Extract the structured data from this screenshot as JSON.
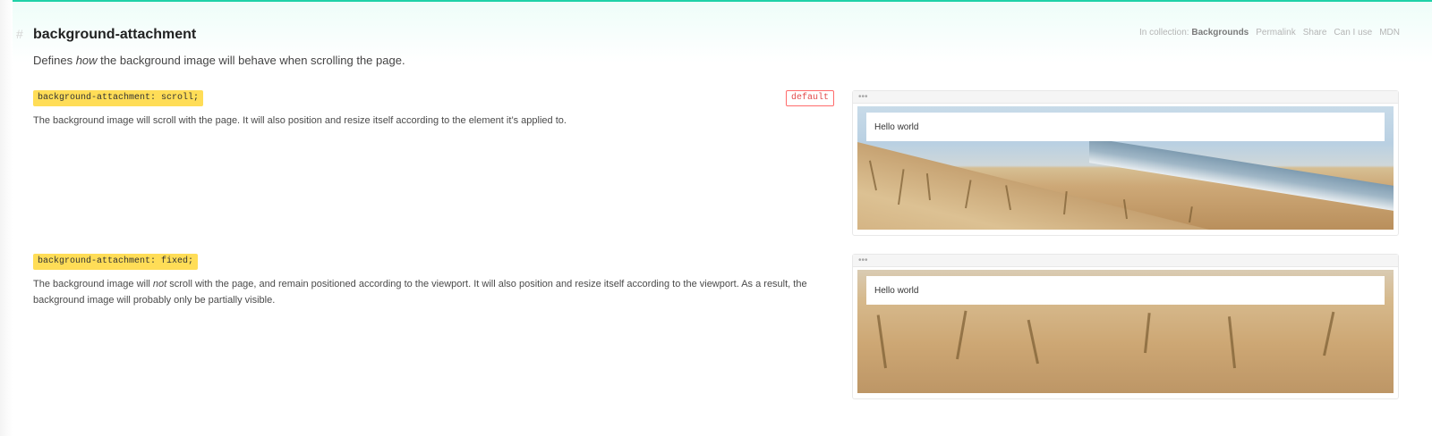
{
  "property": {
    "hash": "#",
    "title": "background-attachment",
    "description_pre": "Defines ",
    "description_em": "how",
    "description_post": " the background image will behave when scrolling the page."
  },
  "meta": {
    "collection_label": "In collection:",
    "collection_name": "Backgrounds",
    "permalink": "Permalink",
    "share": "Share",
    "caniuse": "Can I use",
    "mdn": "MDN"
  },
  "values": [
    {
      "code": "background-attachment: scroll;",
      "default_label": "default",
      "text": "The background image will scroll with the page. It will also position and resize itself according to the element it’s applied to.",
      "example_dots": "•••",
      "example_text": "Hello world"
    },
    {
      "code": "background-attachment: fixed;",
      "text_pre": "The background image will ",
      "text_em": "not",
      "text_post": " scroll with the page, and remain positioned according to the viewport. It will also position and resize itself according to the viewport. As a result, the background image will probably only be partially visible.",
      "example_dots": "•••",
      "example_text": "Hello world"
    }
  ],
  "colors": {
    "accent_line": "#1fd1a8",
    "code_bg": "#ffdd57",
    "default_border": "#ff6b6b"
  }
}
